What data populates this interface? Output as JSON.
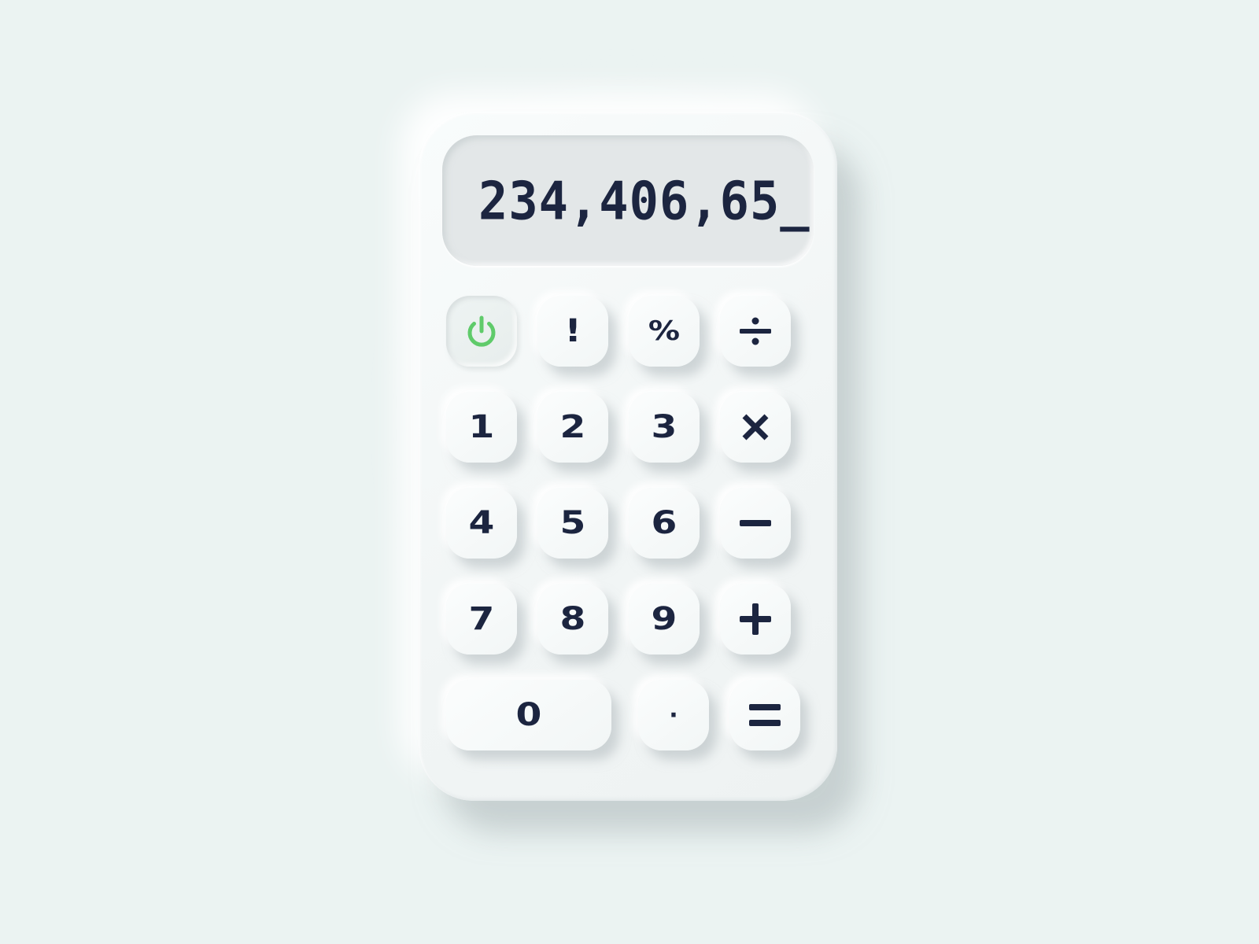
{
  "display": {
    "value": "234,406,65_"
  },
  "keys": {
    "power": {
      "icon": "power-icon",
      "color": "#5fcb6a"
    },
    "factorial": {
      "label": "!"
    },
    "percent": {
      "label": "%"
    },
    "divide": {
      "icon": "divide-icon"
    },
    "one": {
      "label": "1"
    },
    "two": {
      "label": "2"
    },
    "three": {
      "label": "3"
    },
    "multiply": {
      "icon": "multiply-icon"
    },
    "four": {
      "label": "4"
    },
    "five": {
      "label": "5"
    },
    "six": {
      "label": "6"
    },
    "minus": {
      "icon": "minus-icon"
    },
    "seven": {
      "label": "7"
    },
    "eight": {
      "label": "8"
    },
    "nine": {
      "label": "9"
    },
    "plus": {
      "icon": "plus-icon"
    },
    "zero": {
      "label": "0"
    },
    "decimal": {
      "label": "·"
    },
    "equals": {
      "icon": "equals-icon"
    }
  },
  "colors": {
    "background": "#ebf3f2",
    "text": "#1c2540",
    "accent": "#5fcb6a"
  }
}
